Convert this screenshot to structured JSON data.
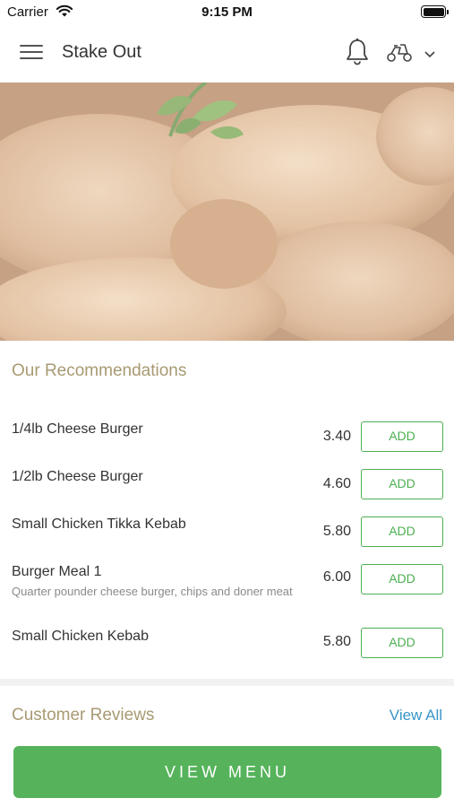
{
  "status_bar": {
    "carrier": "Carrier",
    "time": "9:15 PM"
  },
  "nav": {
    "title": "Stake Out",
    "icons": [
      "menu-icon",
      "bell-icon",
      "scooter-icon",
      "chevron-down-icon"
    ]
  },
  "hero": {
    "image": "roast-chicken-photo"
  },
  "recommendations": {
    "title": "Our Recommendations",
    "items": [
      {
        "name": "1/4lb Cheese Burger",
        "description": "",
        "price": "3.40",
        "button": "ADD"
      },
      {
        "name": "1/2lb Cheese Burger",
        "description": "",
        "price": "4.60",
        "button": "ADD"
      },
      {
        "name": "Small Chicken Tikka Kebab",
        "description": "",
        "price": "5.80",
        "button": "ADD"
      },
      {
        "name": "Burger Meal 1",
        "description": "Quarter pounder cheese burger, chips and doner meat",
        "price": "6.00",
        "button": "ADD"
      },
      {
        "name": "Small Chicken Kebab",
        "description": "",
        "price": "5.80",
        "button": "ADD"
      }
    ]
  },
  "reviews": {
    "title": "Customer Reviews",
    "view_all": "View All"
  },
  "cta": {
    "label": "VIEW MENU"
  },
  "colors": {
    "accent_green": "#56b35b",
    "section_title": "#a89a72",
    "link_blue": "#3a96c8"
  }
}
